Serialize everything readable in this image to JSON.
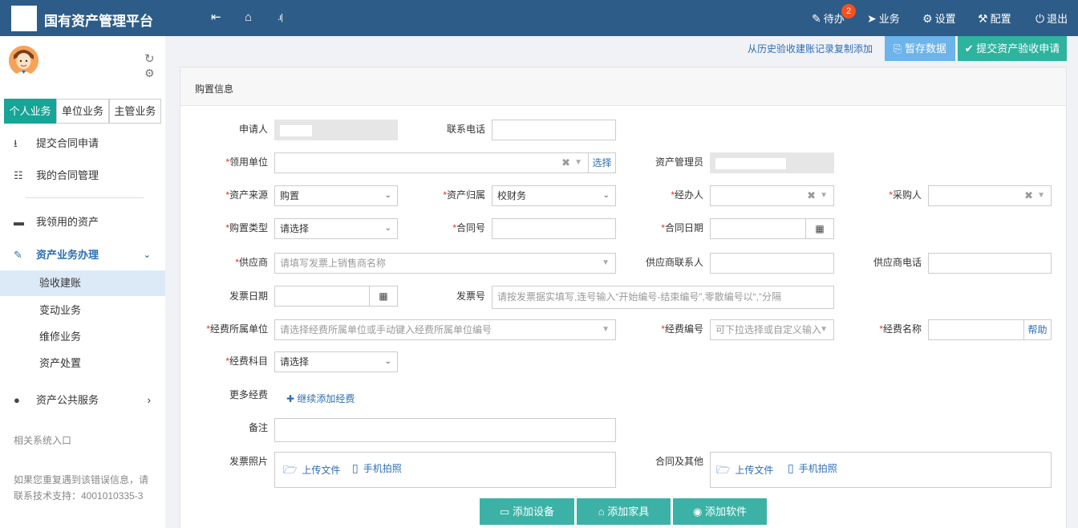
{
  "header": {
    "app_title": "国有资产管理平台",
    "nav_icons": [
      "collapse-left-icon",
      "home-icon",
      "signal-icon"
    ],
    "menu": [
      {
        "icon": "edit-icon",
        "label": "待办"
      },
      {
        "icon": "send-icon",
        "label": "业务"
      },
      {
        "icon": "gear-icon",
        "label": "设置"
      },
      {
        "icon": "tools-icon",
        "label": "配置"
      },
      {
        "icon": "power-icon",
        "label": "退出"
      }
    ],
    "todo_badge": "2"
  },
  "sidebar": {
    "tabs": [
      "个人业务",
      "单位业务",
      "主管业务"
    ],
    "items": [
      {
        "icon": "upload-box-icon",
        "label": "提交合同申请"
      },
      {
        "icon": "document-icon",
        "label": "我的合同管理"
      },
      {
        "icon": "drive-icon",
        "label": "我领用的资产"
      },
      {
        "icon": "pencil-icon",
        "label": "资产业务办理"
      },
      {
        "icon": "globe-icon",
        "label": "资产公共服务"
      }
    ],
    "subitems": [
      "验收建账",
      "变动业务",
      "维修业务",
      "资产处置"
    ],
    "related_systems": "相关系统入口",
    "error_note_line1": "如果您重复遇到该错误信息，请",
    "error_note_line2": "联系技术支持：4001010335-3"
  },
  "actions": {
    "copy_history": "从历史验收建账记录复制添加",
    "save_draft": "暂存数据",
    "submit": "提交资产验收申请"
  },
  "form": {
    "section_title": "购置信息",
    "labels": {
      "applicant": "申请人",
      "phone": "联系电话",
      "dept": "领用单位",
      "asset_admin": "资产管理员",
      "source": "资产来源",
      "belong": "资产归属",
      "handler": "经办人",
      "purchaser": "采购人",
      "purchase_type": "购置类型",
      "contract_no": "合同号",
      "contract_date": "合同日期",
      "supplier": "供应商",
      "supplier_contact": "供应商联系人",
      "supplier_phone": "供应商电话",
      "invoice_date": "发票日期",
      "invoice_no": "发票号",
      "fund_unit": "经费所属单位",
      "fund_code": "经费编号",
      "fund_name": "经费名称",
      "fund_subject": "经费科目",
      "more_fund": "更多经费",
      "remark": "备注",
      "invoice_photo": "发票照片",
      "contract_other": "合同及其他"
    },
    "values": {
      "source": "购置",
      "belong": "校财务",
      "purchase_type": "请选择",
      "fund_subject": "请选择"
    },
    "placeholders": {
      "supplier": "请填写发票上销售商名称",
      "invoice_no": "请按发票据实填写,连号输入“开始编号-结束编号”,零散编号以“,”分隔",
      "fund_unit": "请选择经费所属单位或手动键入经费所属单位编号",
      "fund_code": "可下拉选择或自定义输入"
    },
    "select_btn": "选择",
    "help_btn": "帮助",
    "add_fund": "继续添加经费",
    "upload_file": "上传文件",
    "phone_photo": "手机拍照"
  },
  "bottom_buttons": {
    "add_device": "添加设备",
    "add_furniture": "添加家具",
    "add_software": "添加软件"
  },
  "colors": {
    "header": "#2d5c88",
    "active_tab": "#16a596",
    "link": "#2d6db5",
    "required": "#d9342b",
    "save_btn": "#6cb4ea",
    "submit_btn": "#2db39e",
    "bottom_btn": "#3cb2a6"
  }
}
